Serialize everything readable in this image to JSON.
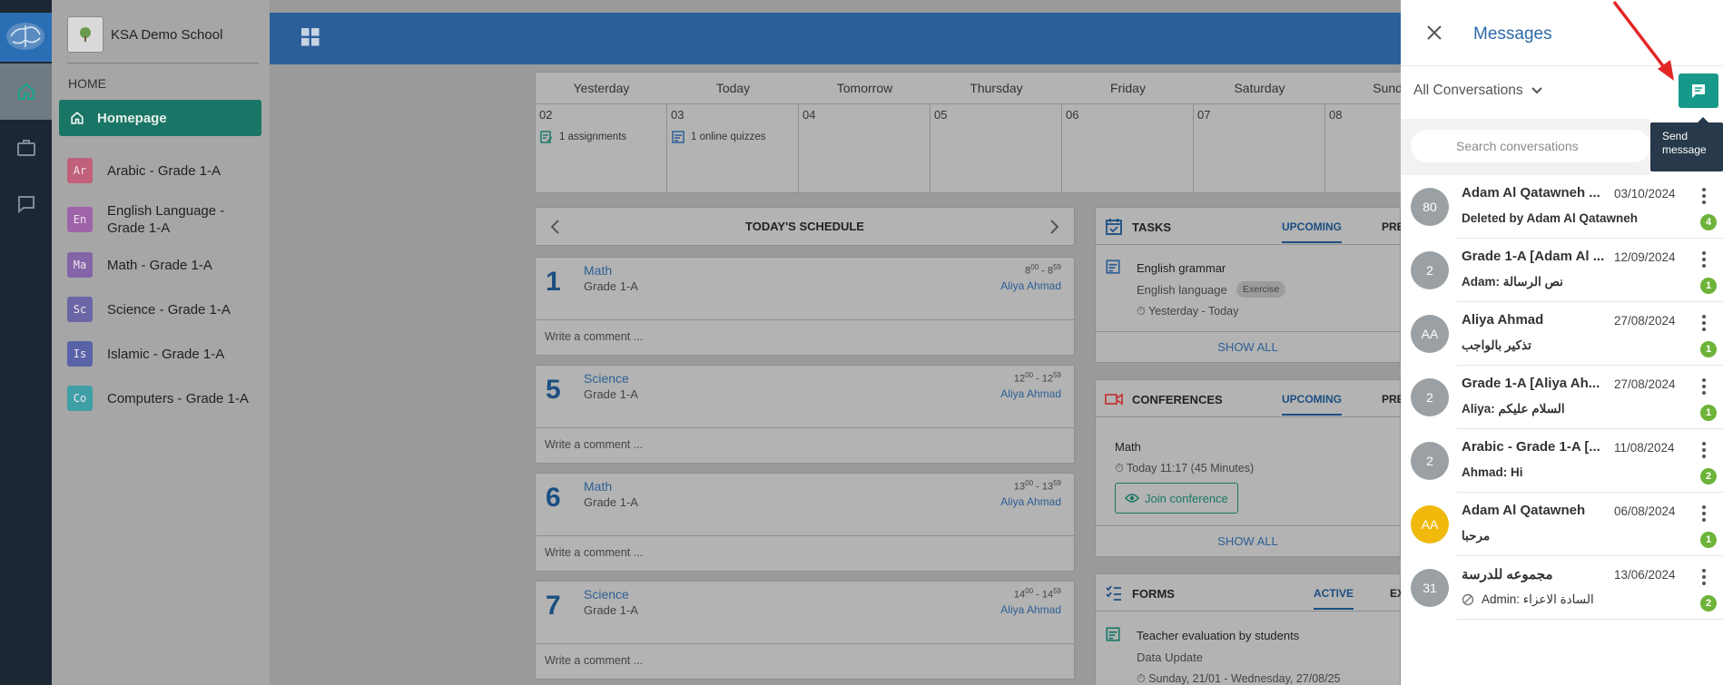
{
  "app": {
    "school_name": "KSA Demo School"
  },
  "rail": {
    "items": [
      {
        "icon": "home-icon"
      },
      {
        "icon": "briefcase-icon"
      },
      {
        "icon": "chat-icon"
      }
    ]
  },
  "sidebar": {
    "section_label": "HOME",
    "homepage_label": "Homepage",
    "courses": [
      {
        "abbr": "Ar",
        "label": "Arabic - Grade 1-A",
        "color": "#c0607a"
      },
      {
        "abbr": "En",
        "label": "English Language - Grade 1-A",
        "color": "#9e63a8"
      },
      {
        "abbr": "Ma",
        "label": "Math - Grade 1-A",
        "color": "#8464a8"
      },
      {
        "abbr": "Sc",
        "label": "Science - Grade 1-A",
        "color": "#6b66a6"
      },
      {
        "abbr": "Is",
        "label": "Islamic - Grade 1-A",
        "color": "#5a63a8"
      },
      {
        "abbr": "Co",
        "label": "Computers - Grade 1-A",
        "color": "#3f9fa6"
      }
    ]
  },
  "calendar": {
    "days": [
      "Yesterday",
      "Today",
      "Tomorrow",
      "Thursday",
      "Friday",
      "Saturday",
      "Sunda"
    ],
    "dates": [
      "02",
      "03",
      "04",
      "05",
      "06",
      "07",
      "08"
    ],
    "events": {
      "0": "1 assignments",
      "1": "1 online quizzes"
    }
  },
  "schedule": {
    "title": "TODAY'S SCHEDULE",
    "lessons": [
      {
        "num": "1",
        "subject": "Math",
        "grade": "Grade 1-A",
        "start_h": "8",
        "start_m": "00",
        "end_h": "8",
        "end_m": "59",
        "teacher": "Aliya Ahmad",
        "comment_placeholder": "Write a comment ..."
      },
      {
        "num": "5",
        "subject": "Science",
        "grade": "Grade 1-A",
        "start_h": "12",
        "start_m": "00",
        "end_h": "12",
        "end_m": "59",
        "teacher": "Aliya Ahmad",
        "comment_placeholder": "Write a comment ..."
      },
      {
        "num": "6",
        "subject": "Math",
        "grade": "Grade 1-A",
        "start_h": "13",
        "start_m": "00",
        "end_h": "13",
        "end_m": "59",
        "teacher": "Aliya Ahmad",
        "comment_placeholder": "Write a comment ..."
      },
      {
        "num": "7",
        "subject": "Science",
        "grade": "Grade 1-A",
        "start_h": "14",
        "start_m": "00",
        "end_h": "14",
        "end_m": "59",
        "teacher": "Aliya Ahmad",
        "comment_placeholder": "Write a comment ..."
      }
    ]
  },
  "tasks": {
    "title": "TASKS",
    "tab_active": "UPCOMING",
    "tab_other": "PRE",
    "item_title": "English grammar",
    "item_subject": "English language",
    "item_tag": "Exercise",
    "item_time": "Yesterday - Today",
    "show_all": "SHOW ALL"
  },
  "conferences": {
    "title": "CONFERENCES",
    "tab_active": "UPCOMING",
    "tab_other": "PRE",
    "item_title": "Math",
    "item_time": "Today 11:17 (45 Minutes)",
    "join_label": "Join conference",
    "show_all": "SHOW ALL"
  },
  "forms": {
    "title": "FORMS",
    "tab_active": "ACTIVE",
    "tab_other": "EX",
    "item_title": "Teacher evaluation by students",
    "item_sub": "Data Update",
    "item_time": "Sunday, 21/01 - Wednesday, 27/08/25"
  },
  "messages": {
    "title": "Messages",
    "filter_label": "All Conversations",
    "send_tooltip_line1": "Send",
    "send_tooltip_line2": "message",
    "search_placeholder": "Search conversations",
    "conversations": [
      {
        "avatar": "80",
        "avatar_color": "#9aa0a3",
        "name": "Adam Al Qatawneh ...",
        "date": "03/10/2024",
        "preview": "Deleted by Adam Al Qatawneh",
        "count": "4",
        "blocked": false
      },
      {
        "avatar": "2",
        "avatar_color": "#9aa0a3",
        "name": "Grade 1-A [Adam Al ...",
        "date": "12/09/2024",
        "preview": "Adam: نص الرسالة",
        "count": "1",
        "blocked": false
      },
      {
        "avatar": "AA",
        "avatar_color": "#9aa0a3",
        "name": "Aliya Ahmad",
        "date": "27/08/2024",
        "preview": "تذكير بالواجب",
        "count": "1",
        "blocked": false
      },
      {
        "avatar": "2",
        "avatar_color": "#9aa0a3",
        "name": "Grade 1-A [Aliya Ah...",
        "date": "27/08/2024",
        "preview": "Aliya: السلام عليكم",
        "count": "1",
        "blocked": false
      },
      {
        "avatar": "2",
        "avatar_color": "#9aa0a3",
        "name": "Arabic - Grade 1-A [...",
        "date": "11/08/2024",
        "preview": "Ahmad: Hi",
        "count": "2",
        "blocked": false
      },
      {
        "avatar": "AA",
        "avatar_color": "#f0b90c",
        "name": "Adam Al Qatawneh",
        "date": "06/08/2024",
        "preview": "مرحبا",
        "count": "1",
        "blocked": false
      },
      {
        "avatar": "31",
        "avatar_color": "#9aa0a3",
        "name": "مجموعه للدرسة",
        "date": "13/06/2024",
        "preview": "Admin: السادة الاعزاء",
        "count": "2",
        "blocked": true
      }
    ]
  },
  "colors": {
    "accent": "#16998a",
    "brand_blue": "#2d6aa8",
    "badge_green": "#6db339"
  }
}
